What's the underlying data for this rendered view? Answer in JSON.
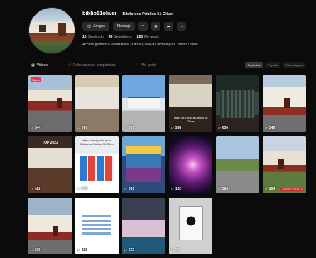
{
  "profile": {
    "username": "biblio51oliver",
    "display_name": "Biblioteca Pública 51 Oliver",
    "buttons": {
      "friends": "Amigos",
      "message": "Mensaje"
    },
    "stats": [
      {
        "value": "16",
        "label": "Siguiendo"
      },
      {
        "value": "48",
        "label": "Seguidores"
      },
      {
        "value": "225",
        "label": "Me gusta"
      }
    ],
    "bio": "Acceso gratuito a la literatura, cultura y nuevas tecnologías. biblio51oliver"
  },
  "tabs": [
    {
      "label": "Videos",
      "icon": "grid-icon",
      "active": true
    },
    {
      "label": "Publicaciones compartidas",
      "icon": "repost-icon",
      "active": false
    },
    {
      "label": "Me gustó",
      "icon": "heart-icon",
      "active": false
    }
  ],
  "sort": [
    "Recientes",
    "Popular",
    "Más antiguos"
  ],
  "videos": [
    {
      "views": "344",
      "pinned": "Fijado"
    },
    {
      "views": "567"
    },
    {
      "views": "301"
    },
    {
      "views": "388",
      "caption": "Taller de Lectura Centro de Oliver"
    },
    {
      "views": "630"
    },
    {
      "views": "346"
    },
    {
      "views": "422",
      "caption": "TOP 2023"
    },
    {
      "views": "638",
      "caption": "Hay subscripción en la Biblioteca Pública 51 Oliver"
    },
    {
      "views": "631"
    },
    {
      "views": "182"
    },
    {
      "views": "386"
    },
    {
      "views": "284",
      "tag": "LA BIBLIOTECA"
    },
    {
      "views": "256"
    },
    {
      "views": "226"
    },
    {
      "views": "223"
    },
    {
      "views": "36"
    }
  ],
  "colors": {
    "background": "#0b0b0b",
    "accent": "#fe2c55"
  }
}
